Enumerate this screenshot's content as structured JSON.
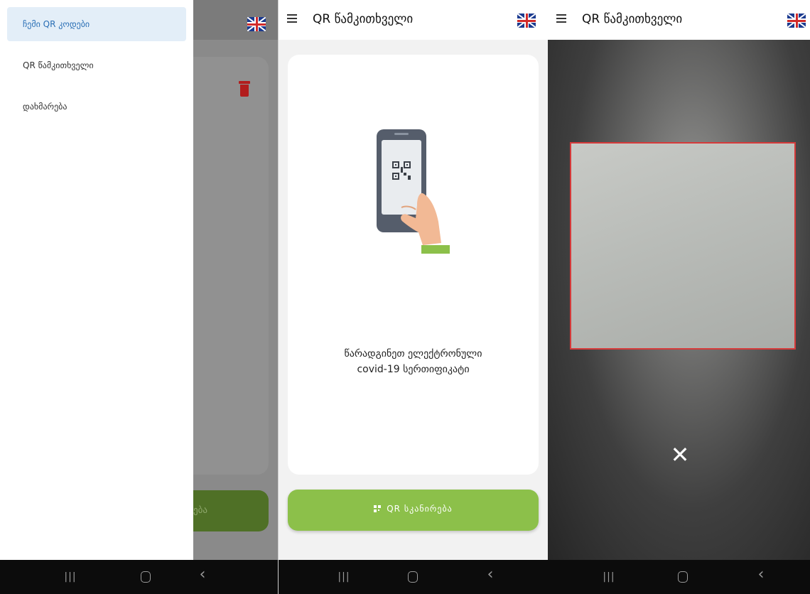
{
  "screen1": {
    "drawer_items": [
      {
        "label": "ჩემი QR კოდები"
      },
      {
        "label": "QR წამკითხველი"
      },
      {
        "label": "დახმარება"
      }
    ],
    "bottom_button_fragment": "ება"
  },
  "screen2": {
    "title": "QR წამკითხველი",
    "prompt_line1": "წარადგინეთ ელექტრონული",
    "prompt_line2": "covid-19 სერთიფიკატი",
    "scan_button_label": "QR სკანირება"
  },
  "screen3": {
    "title": "QR წამკითხველი",
    "close_symbol": "✕"
  },
  "navbar": {
    "recent_symbol": "|||",
    "back_symbol": "‹"
  },
  "colors": {
    "accent_green": "#8cc04a",
    "scan_frame_red": "#d63a3a",
    "drawer_active_bg": "#e3eef8",
    "delete_red": "#b21d1d"
  },
  "icons": [
    "hamburger-icon",
    "uk-flag-icon",
    "trash-icon",
    "qr-icon",
    "phone-scan-illustration",
    "close-icon",
    "nav-recent-icon",
    "nav-home-icon",
    "nav-back-icon"
  ]
}
